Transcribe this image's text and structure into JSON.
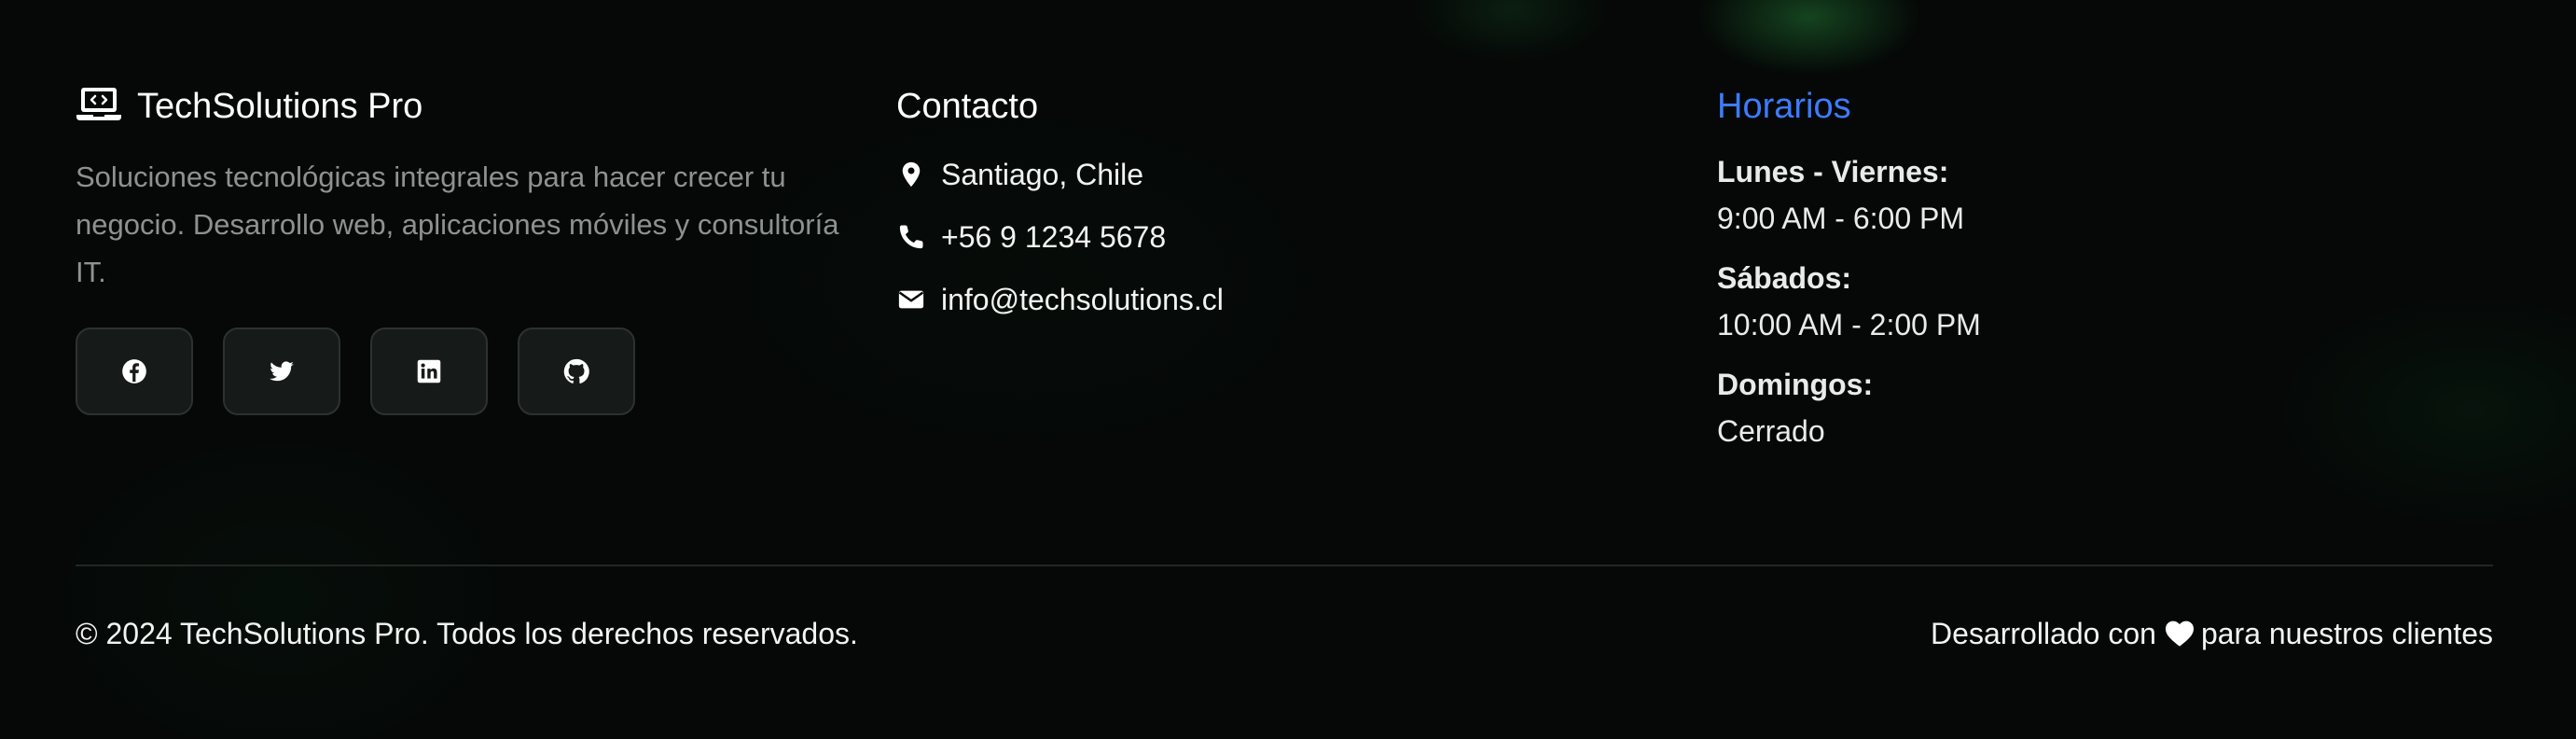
{
  "brand": {
    "name": "TechSolutions Pro",
    "description": "Soluciones tecnológicas integrales para hacer crecer tu negocio. Desarrollo web, aplicaciones móviles y consultoría IT.",
    "logo_icon": "laptop-code-icon",
    "socials": [
      {
        "name": "facebook",
        "icon": "facebook-icon"
      },
      {
        "name": "twitter",
        "icon": "twitter-icon"
      },
      {
        "name": "linkedin",
        "icon": "linkedin-icon"
      },
      {
        "name": "github",
        "icon": "github-icon"
      }
    ]
  },
  "contact": {
    "title": "Contacto",
    "address": "Santiago, Chile",
    "phone": "+56 9 1234 5678",
    "email": "info@techsolutions.cl",
    "icons": [
      "map-pin-icon",
      "phone-icon",
      "envelope-icon"
    ]
  },
  "hours": {
    "title": "Horarios",
    "entries": [
      {
        "day": "Lunes - Viernes:",
        "time": "9:00 AM - 6:00 PM"
      },
      {
        "day": "Sábados:",
        "time": "10:00 AM - 2:00 PM"
      },
      {
        "day": "Domingos:",
        "time": "Cerrado"
      }
    ]
  },
  "bottom": {
    "copyright": "© 2024 TechSolutions Pro. Todos los derechos reservados.",
    "made_with_prefix": "Desarrollado con",
    "made_with_suffix": "para nuestros clientes",
    "heart_icon": "heart-icon"
  },
  "colors": {
    "background": "#050807",
    "accent_blue": "#3d7bff",
    "muted_text": "#8d9290",
    "button_bg": "#161a19",
    "glow_green": "#288c3c"
  }
}
